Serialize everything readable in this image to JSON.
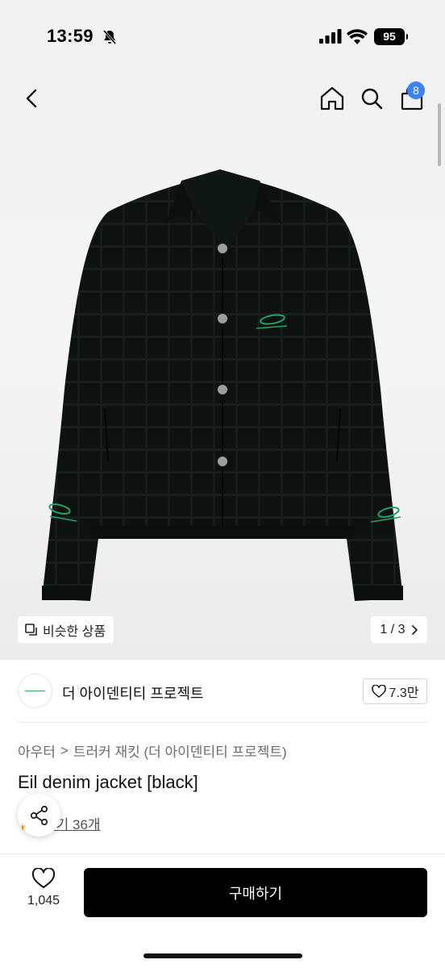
{
  "status_bar": {
    "time": "13:59",
    "battery": "95"
  },
  "nav": {
    "cart_badge": "8"
  },
  "gallery": {
    "similar_label": "비슷한 상품",
    "page_indicator": "1 / 3"
  },
  "brand": {
    "name": "더 아이덴티티 프로젝트",
    "likes": "7.3만"
  },
  "category": {
    "level1": "아우터",
    "separator": ">",
    "level2": "트러커 재킷 (더 아이덴티티 프로젝트)"
  },
  "product": {
    "title": "Eil denim jacket [black]",
    "reviews": "후기 36개"
  },
  "bottom_bar": {
    "wish_count": "1,045",
    "buy_label": "구매하기"
  },
  "colors": {
    "accent_badge": "#3b82f6",
    "buy_button": "#000000",
    "embroidery": "#1fa46a"
  },
  "icons": [
    "bell-off-icon",
    "signal-icon",
    "wifi-icon",
    "back-icon",
    "home-icon",
    "search-icon",
    "bag-icon",
    "copy-icon",
    "chevron-right-icon",
    "heart-icon",
    "share-icon"
  ]
}
